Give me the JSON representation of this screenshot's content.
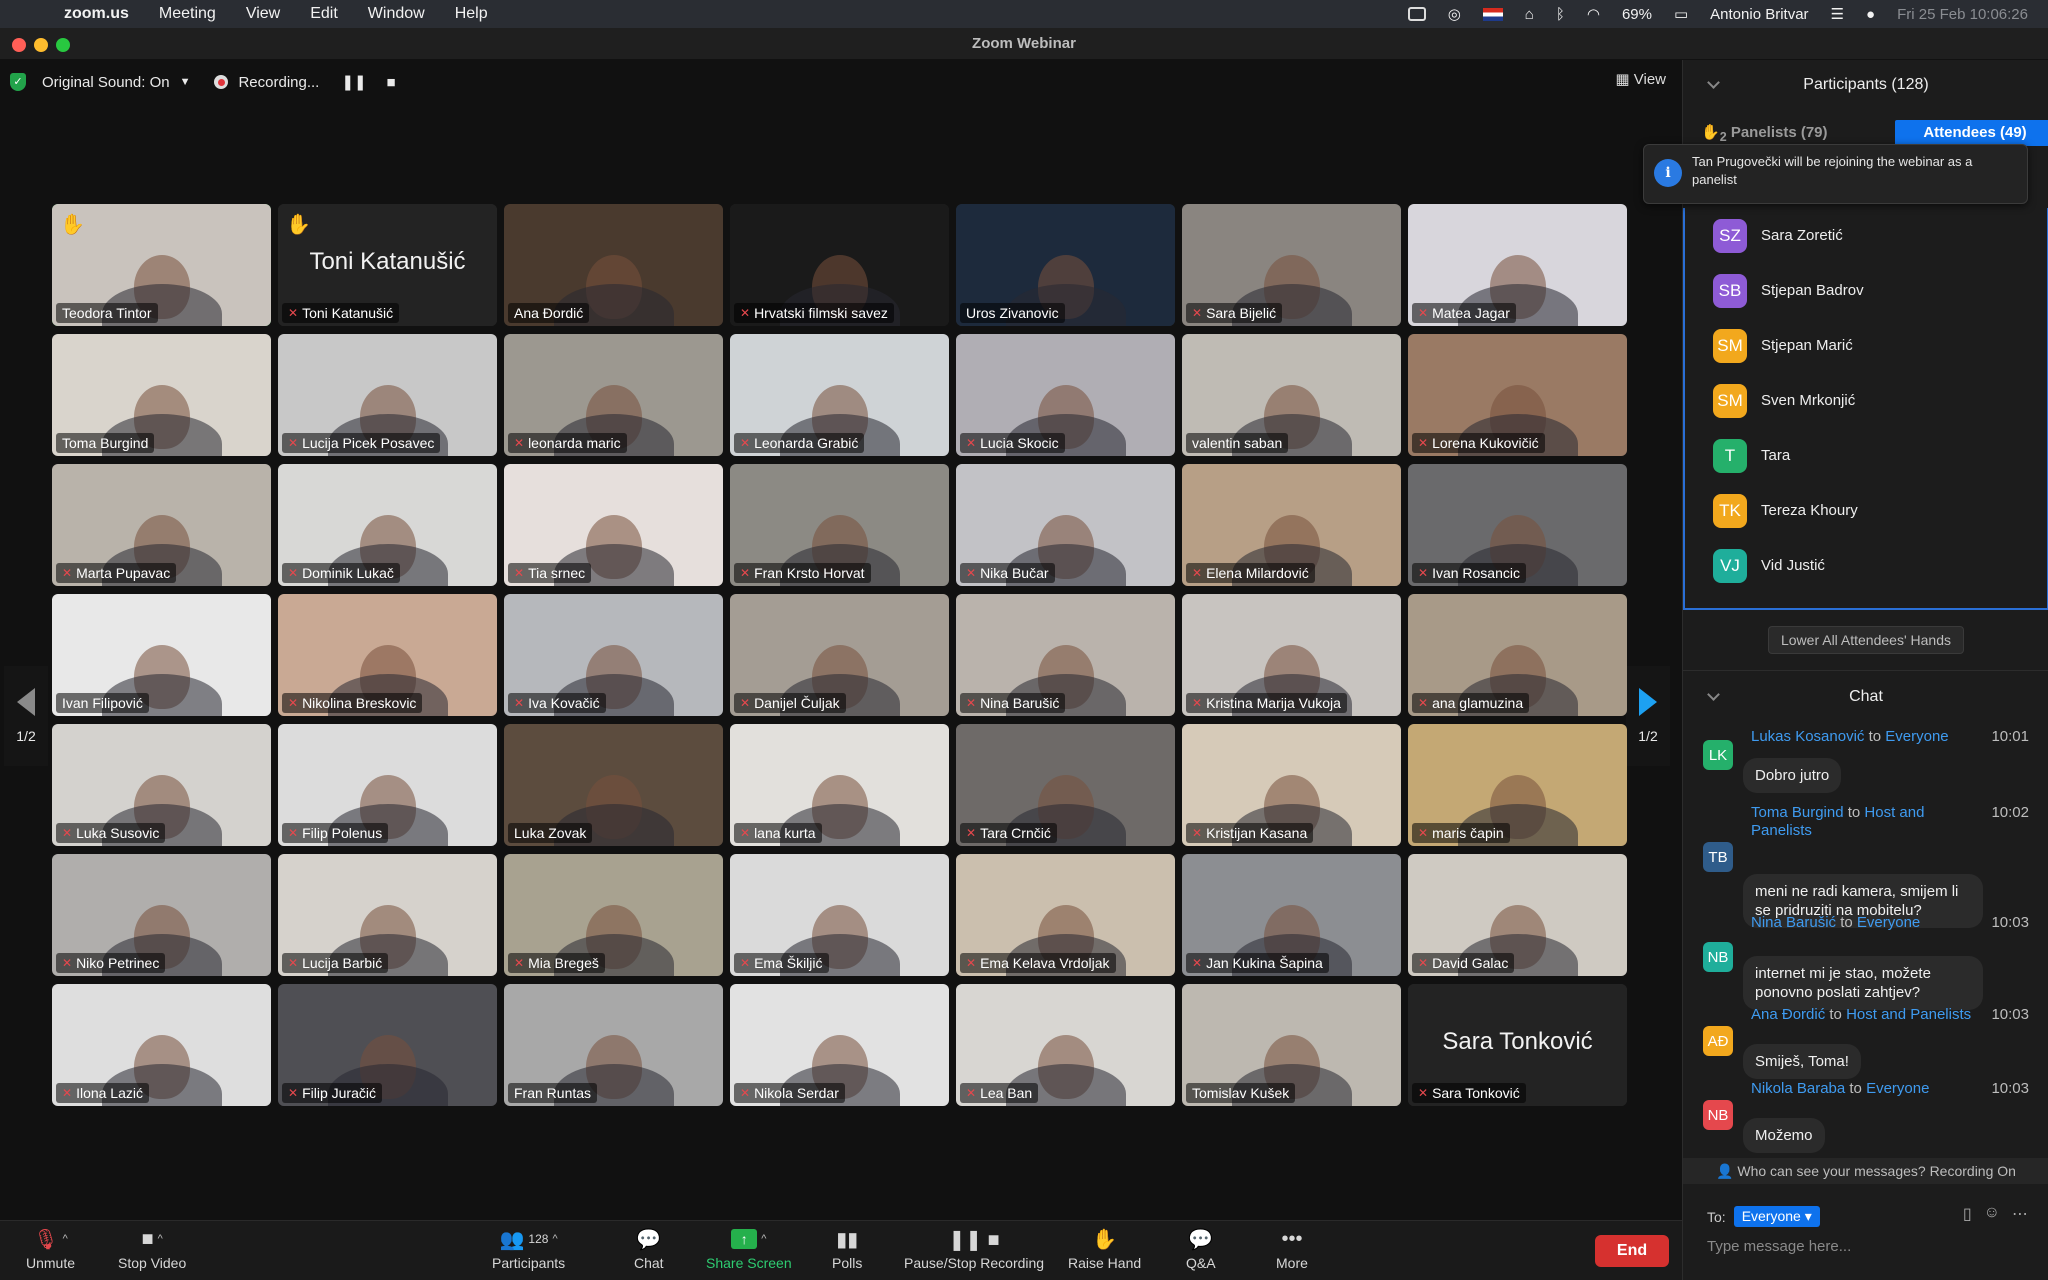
{
  "menubar": {
    "app": "zoom.us",
    "items": [
      "Meeting",
      "View",
      "Edit",
      "Window",
      "Help"
    ],
    "battery": "69%",
    "user": "Antonio Britvar",
    "datetime": "Fri 25 Feb  10:06:26"
  },
  "window": {
    "title": "Zoom Webinar"
  },
  "stage": {
    "original_sound": "Original Sound: On",
    "recording": "Recording...",
    "view": "View",
    "page": "1/2"
  },
  "tiles": [
    {
      "name": "Teodora Tintor",
      "muted": false,
      "active": true,
      "hand": true,
      "bg": "#c9c3bd"
    },
    {
      "name": "Toni Katanušić",
      "muted": true,
      "hand": true,
      "big": "Toni Katanušić",
      "bg": "#232323"
    },
    {
      "name": "Ana Đordić",
      "muted": false,
      "bg": "#4a3a2e"
    },
    {
      "name": "Hrvatski filmski savez",
      "muted": true,
      "bg": "#1a1a1a"
    },
    {
      "name": "Uros Zivanovic",
      "muted": false,
      "bg": "#1d2a3c"
    },
    {
      "name": "Sara Bijelić",
      "muted": true,
      "bg": "#8a8580"
    },
    {
      "name": "Matea Jagar",
      "muted": true,
      "bg": "#d8d6dc"
    },
    {
      "name": "Toma Burgind",
      "muted": false,
      "bg": "#d9d4cc"
    },
    {
      "name": "Lucija Picek Posavec",
      "muted": true,
      "bg": "#c8c8c8"
    },
    {
      "name": "leonarda maric",
      "muted": true,
      "bg": "#9c9890"
    },
    {
      "name": "Leonarda Grabić",
      "muted": true,
      "bg": "#cfd3d6"
    },
    {
      "name": "Lucia Skocic",
      "muted": true,
      "bg": "#b0aeb4"
    },
    {
      "name": "valentin saban",
      "muted": false,
      "bg": "#bfbbb4"
    },
    {
      "name": "Lorena Kukovičić",
      "muted": true,
      "bg": "#9a7a64"
    },
    {
      "name": "Marta Pupavac",
      "muted": true,
      "bg": "#b9b3aa"
    },
    {
      "name": "Dominik Lukač",
      "muted": true,
      "bg": "#d8d8d6"
    },
    {
      "name": "Tia srnec",
      "muted": true,
      "bg": "#e6dfdc"
    },
    {
      "name": "Fran Krsto Horvat",
      "muted": true,
      "bg": "#8c8a84"
    },
    {
      "name": "Nika Bučar",
      "muted": true,
      "bg": "#c2c2c6"
    },
    {
      "name": "Elena Milardović",
      "muted": true,
      "bg": "#b79f86"
    },
    {
      "name": "Ivan Rosancic",
      "muted": true,
      "bg": "#6a6a6c"
    },
    {
      "name": "Ivan Filipović",
      "muted": false,
      "bg": "#e8e8e8"
    },
    {
      "name": "Nikolina Breskovic",
      "muted": true,
      "bg": "#c9a994"
    },
    {
      "name": "Iva Kovačić",
      "muted": true,
      "bg": "#b6b8bc"
    },
    {
      "name": "Danijel Čuljak",
      "muted": true,
      "bg": "#a49d94"
    },
    {
      "name": "Nina Barušić",
      "muted": true,
      "bg": "#bab3ac"
    },
    {
      "name": "Kristina Marija Vukoja",
      "muted": true,
      "bg": "#c8c4c0"
    },
    {
      "name": "ana glamuzina",
      "muted": true,
      "bg": "#a89a88"
    },
    {
      "name": "Luka Susovic",
      "muted": true,
      "bg": "#d4d2ce"
    },
    {
      "name": "Filip Polenus",
      "muted": true,
      "bg": "#dcdcdc"
    },
    {
      "name": "Luka Zovak",
      "muted": false,
      "bg": "#5c4c3e"
    },
    {
      "name": "lana kurta",
      "muted": true,
      "bg": "#e2e0dc"
    },
    {
      "name": "Tara Crnčić",
      "muted": true,
      "bg": "#6e6a68"
    },
    {
      "name": "Kristijan Kasana",
      "muted": true,
      "bg": "#d6cab8"
    },
    {
      "name": "maris čapin",
      "muted": true,
      "bg": "#c4a874"
    },
    {
      "name": "Niko Petrinec",
      "muted": true,
      "bg": "#b0aeac"
    },
    {
      "name": "Lucija Barbić",
      "muted": true,
      "bg": "#d6d2cc"
    },
    {
      "name": "Mia Bregeš",
      "muted": true,
      "bg": "#a8a290"
    },
    {
      "name": "Ema Škiljić",
      "muted": true,
      "bg": "#dadada"
    },
    {
      "name": "Ema Kelava Vrdoljak",
      "muted": true,
      "bg": "#cbbfae"
    },
    {
      "name": "Jan Kukina Šapina",
      "muted": true,
      "bg": "#8c8e92"
    },
    {
      "name": "David Galac",
      "muted": true,
      "bg": "#cfcac2"
    },
    {
      "name": "Ilona Lazić",
      "muted": true,
      "bg": "#dedede"
    },
    {
      "name": "Filip Juračić",
      "muted": true,
      "bg": "#4f4f54"
    },
    {
      "name": "Fran Runtas",
      "muted": false,
      "bg": "#a8a8a8"
    },
    {
      "name": "Nikola Serdar",
      "muted": true,
      "bg": "#e2e2e2"
    },
    {
      "name": "Lea Ban",
      "muted": true,
      "bg": "#d8d6d2"
    },
    {
      "name": "Tomislav Kušek",
      "muted": false,
      "bg": "#bdb8b0"
    },
    {
      "name": "Sara Tonković",
      "muted": true,
      "big": "Sara Tonković",
      "bg": "#232323"
    }
  ],
  "toolbar": {
    "unmute": "Unmute",
    "stop_video": "Stop Video",
    "participants": "Participants",
    "participants_count": "128",
    "chat": "Chat",
    "share": "Share Screen",
    "polls": "Polls",
    "record": "Pause/Stop Recording",
    "raise": "Raise Hand",
    "qa": "Q&A",
    "more": "More",
    "end": "End"
  },
  "participants": {
    "title": "Participants (128)",
    "hand_count": "2",
    "panelists": "Panelists (79)",
    "attendees": "Attendees (49)",
    "toast": "Tan Prugovečki will be rejoining the webinar as a panelist",
    "lower": "Lower All Attendees' Hands",
    "list": [
      {
        "initials": "SZ",
        "name": "Sara Zoretić",
        "color": "#8e5bd6"
      },
      {
        "initials": "SB",
        "name": "Stjepan Badrov",
        "color": "#8e5bd6"
      },
      {
        "initials": "SM",
        "name": "Stjepan Marić",
        "color": "#f2a81d"
      },
      {
        "initials": "SM",
        "name": "Sven Mrkonjić",
        "color": "#f2a81d"
      },
      {
        "initials": "T",
        "name": "Tara",
        "color": "#25b06b"
      },
      {
        "initials": "TK",
        "name": "Tereza Khoury",
        "color": "#f2a81d"
      },
      {
        "initials": "VJ",
        "name": "Vid Justić",
        "color": "#1fae9b"
      }
    ]
  },
  "chat": {
    "title": "Chat",
    "messages": [
      {
        "initials": "LK",
        "color": "#25b06b",
        "from": "Lukas Kosanović",
        "to_word": "to",
        "to": "Everyone",
        "time": "10:01",
        "text": "Dobro jutro"
      },
      {
        "initials": "TB",
        "color": "#2f5c8a",
        "from": "Toma Burgind",
        "to_word": "to",
        "to": "Host and Panelists",
        "time": "10:02",
        "text": "meni ne radi kamera, smijem li se pridruziti na mobitelu?"
      },
      {
        "initials": "NB",
        "color": "#1fae9b",
        "from": "Nina Barušić",
        "to_word": "to",
        "to": "Everyone",
        "time": "10:03",
        "text": "internet mi je stao, možete ponovno poslati zahtjev?"
      },
      {
        "initials": "AĐ",
        "color": "#f2a81d",
        "from": "Ana Đordić",
        "to_word": "to",
        "to": "Host and Panelists",
        "time": "10:03",
        "text": "Smiješ, Toma!"
      },
      {
        "initials": "NB",
        "color": "#e5484d",
        "from": "Nikola Baraba",
        "to_word": "to",
        "to": "Everyone",
        "time": "10:03",
        "text": "Možemo"
      }
    ],
    "who_can": "Who can see your messages? Recording On",
    "to_label": "To:",
    "to_value": "Everyone",
    "placeholder": "Type message here..."
  }
}
